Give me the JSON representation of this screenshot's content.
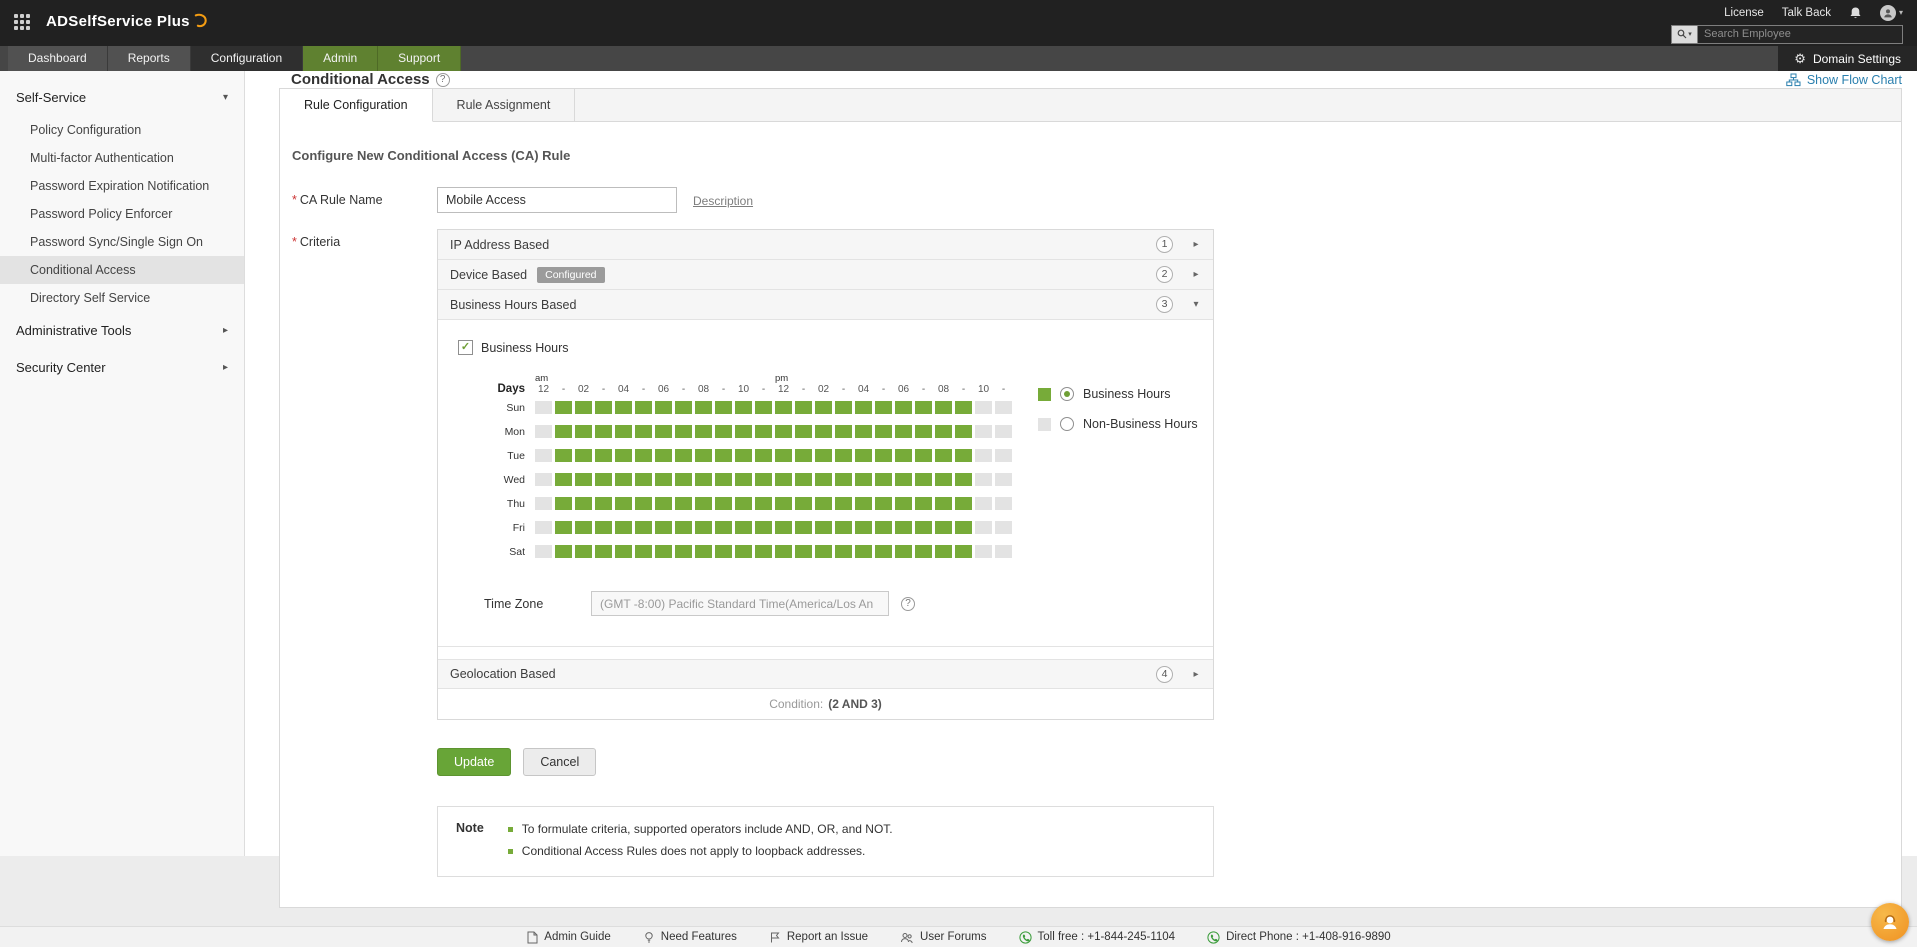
{
  "topbar": {
    "logo": "ADSelfService Plus",
    "license": "License",
    "talkback": "Talk Back",
    "search_placeholder": "Search Employee"
  },
  "nav": {
    "tabs": [
      {
        "label": "Dashboard",
        "style": "dark"
      },
      {
        "label": "Reports",
        "style": "dark"
      },
      {
        "label": "Configuration",
        "style": "active"
      },
      {
        "label": "Admin",
        "style": "green"
      },
      {
        "label": "Support",
        "style": "green"
      }
    ],
    "domain_settings": "Domain Settings"
  },
  "sidebar": {
    "sections": [
      {
        "label": "Self-Service",
        "expanded": true,
        "items": [
          {
            "label": "Policy Configuration",
            "selected": false
          },
          {
            "label": "Multi-factor Authentication",
            "selected": false
          },
          {
            "label": "Password Expiration Notification",
            "selected": false
          },
          {
            "label": "Password Policy Enforcer",
            "selected": false
          },
          {
            "label": "Password Sync/Single Sign On",
            "selected": false
          },
          {
            "label": "Conditional Access",
            "selected": true
          },
          {
            "label": "Directory Self Service",
            "selected": false
          }
        ]
      },
      {
        "label": "Administrative Tools",
        "expanded": false,
        "items": []
      },
      {
        "label": "Security Center",
        "expanded": false,
        "items": []
      }
    ]
  },
  "page": {
    "title": "Conditional Access",
    "show_flow_chart": "Show Flow Chart",
    "tabs": [
      {
        "label": "Rule Configuration",
        "active": true
      },
      {
        "label": "Rule Assignment",
        "active": false
      }
    ],
    "heading": "Configure New Conditional Access (CA) Rule",
    "form": {
      "rule_name_label": "CA Rule Name",
      "rule_name_value": "Mobile Access",
      "description_link": "Description",
      "criteria_label": "Criteria"
    },
    "accordions": [
      {
        "label": "IP Address Based",
        "number": "1"
      },
      {
        "label": "Device Based",
        "number": "2",
        "badge": "Configured"
      },
      {
        "label": "Business Hours Based",
        "number": "3"
      },
      {
        "label": "Geolocation Based",
        "number": "4"
      }
    ],
    "business_hours": {
      "checkbox_label": "Business Hours",
      "days_col_header": "Days",
      "am_label": "am",
      "pm_label": "pm",
      "hour_labels": [
        "12",
        "-",
        "02",
        "-",
        "04",
        "-",
        "06",
        "-",
        "08",
        "-",
        "10",
        "-",
        "12",
        "-",
        "02",
        "-",
        "04",
        "-",
        "06",
        "-",
        "08",
        "-",
        "10",
        "-"
      ],
      "days": [
        "Sun",
        "Mon",
        "Tue",
        "Wed",
        "Thu",
        "Fri",
        "Sat"
      ],
      "selected_pattern": [
        0,
        1,
        1,
        1,
        1,
        1,
        1,
        1,
        1,
        1,
        1,
        1,
        1,
        1,
        1,
        1,
        1,
        1,
        1,
        1,
        1,
        1,
        0,
        0
      ],
      "legend": [
        {
          "label": "Business Hours",
          "selected": true,
          "swatch": "#77ab39"
        },
        {
          "label": "Non-Business Hours",
          "selected": false,
          "swatch": "#e3e3e3"
        }
      ],
      "timezone_label": "Time Zone",
      "timezone_value": "(GMT -8:00) Pacific Standard Time(America/Los An"
    },
    "condition_prefix": "Condition:",
    "condition_value": "(2 AND 3)",
    "update_button": "Update",
    "cancel_button": "Cancel",
    "note": {
      "title": "Note",
      "items": [
        "To formulate criteria, supported operators include AND, OR, and NOT.",
        "Conditional Access Rules does not apply to loopback addresses."
      ]
    }
  },
  "footer": {
    "links": [
      {
        "label": "Admin Guide",
        "icon": "document-icon"
      },
      {
        "label": "Need Features",
        "icon": "lightbulb-icon"
      },
      {
        "label": "Report an Issue",
        "icon": "flag-icon"
      },
      {
        "label": "User Forums",
        "icon": "people-icon"
      },
      {
        "label": "Toll free : +1-844-245-1104",
        "icon": "phone-icon"
      },
      {
        "label": "Direct Phone : +1-408-916-9890",
        "icon": "phone-icon"
      }
    ]
  },
  "colors": {
    "accent_green": "#77ab39",
    "link_blue": "#2a7fae"
  }
}
